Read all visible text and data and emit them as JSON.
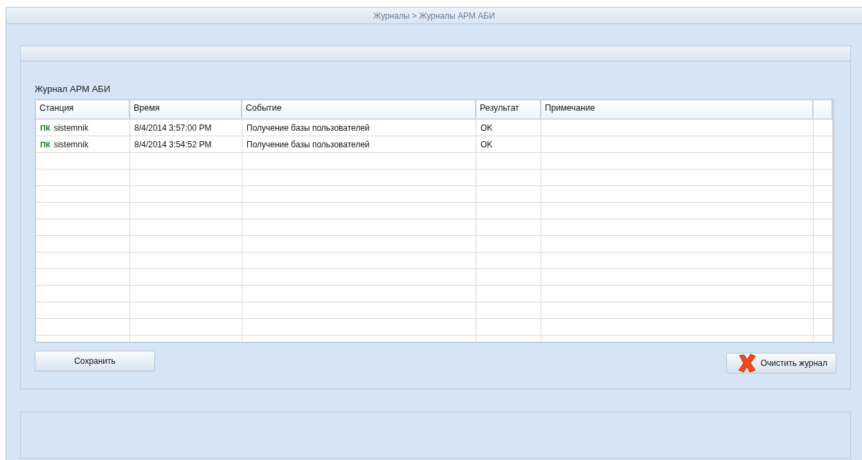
{
  "breadcrumb": "Журналы > Журналы АРМ АБИ",
  "journal": {
    "title": "Журнал АРМ АБИ",
    "columns": [
      "Станция",
      "Время",
      "Событие",
      "Результат",
      "Примечание"
    ],
    "rows": [
      {
        "badge": "ПК",
        "station": "sistemnik",
        "time": "8/4/2014 3:57:00 PM",
        "event": "Получение базы пользователей",
        "result": "OK"
      },
      {
        "badge": "ПК",
        "station": "sistemnik",
        "time": "8/4/2014 3:54:52 PM",
        "event": "Получение базы пользователей",
        "result": "OK"
      }
    ]
  },
  "buttons": {
    "save": "Сохранить",
    "clear": "Очистить журнал"
  }
}
